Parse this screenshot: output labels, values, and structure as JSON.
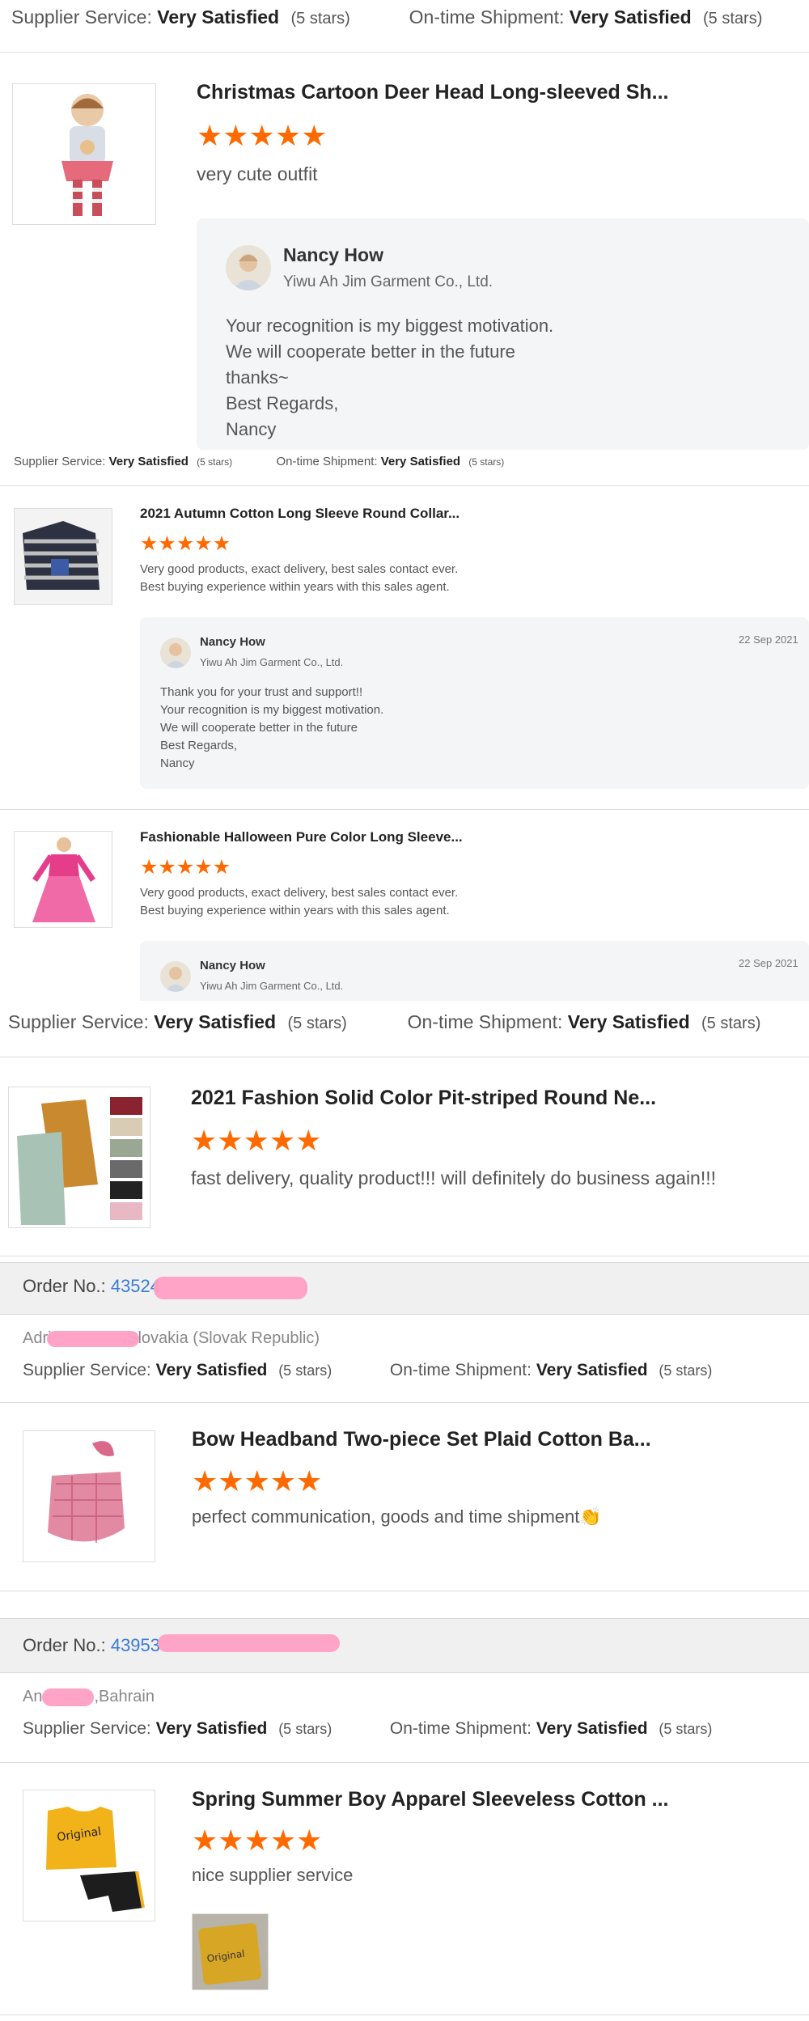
{
  "labels": {
    "supplier_service": "Supplier Service:",
    "ontime_shipment": "On-time Shipment:",
    "very_satisfied": "Very Satisfied",
    "five_stars": "(5 stars)",
    "order_no": "Order No.:"
  },
  "colors": {
    "star": "#ff6a00",
    "link": "#3a7bd5",
    "redaction": "#ff9ec4"
  },
  "reviews": [
    {
      "title": "Christmas Cartoon Deer Head Long-sleeved Sh...",
      "stars": 5,
      "text": "very cute outfit",
      "reply": {
        "name": "Nancy How",
        "company": "Yiwu Ah Jim Garment Co., Ltd.",
        "lines": [
          "Your recognition is my biggest motivation.",
          "We will cooperate better in the future",
          "thanks~",
          "Best Regards,",
          "Nancy"
        ]
      }
    },
    {
      "title": "2021 Autumn Cotton Long Sleeve Round Collar...",
      "stars": 5,
      "text_lines": [
        "Very good products, exact delivery, best sales contact ever.",
        "Best buying experience within years with this sales agent."
      ],
      "reply": {
        "name": "Nancy How",
        "company": "Yiwu Ah Jim Garment Co., Ltd.",
        "date": "22 Sep 2021",
        "lines": [
          "Thank you for your trust and support!!",
          "Your recognition is my biggest motivation.",
          "We will cooperate better in the future",
          "Best Regards,",
          "Nancy"
        ]
      }
    },
    {
      "title": "Fashionable Halloween Pure Color Long Sleeve...",
      "stars": 5,
      "text_lines": [
        "Very good products, exact delivery, best sales contact ever.",
        "Best buying experience within years with this sales agent."
      ],
      "reply": {
        "name": "Nancy How",
        "company": "Yiwu Ah Jim Garment Co., Ltd.",
        "date": "22 Sep 2021"
      }
    },
    {
      "title": "2021 Fashion Solid Color Pit-striped Round Ne...",
      "stars": 5,
      "text": "fast delivery, quality product!!! will definitely do business again!!!"
    },
    {
      "order_no": "43524",
      "buyer_prefix": "Adri",
      "buyer_country": ",Slovakia (Slovak Republic)",
      "title": "Bow Headband Two-piece Set Plaid Cotton Ba...",
      "stars": 5,
      "text": "perfect communication, goods and time shipment👏"
    },
    {
      "order_no": "43953",
      "buyer_prefix": "An",
      "buyer_country": ",Bahrain",
      "title": "Spring Summer Boy Apparel Sleeveless Cotton ...",
      "stars": 5,
      "text": "nice supplier service"
    }
  ]
}
